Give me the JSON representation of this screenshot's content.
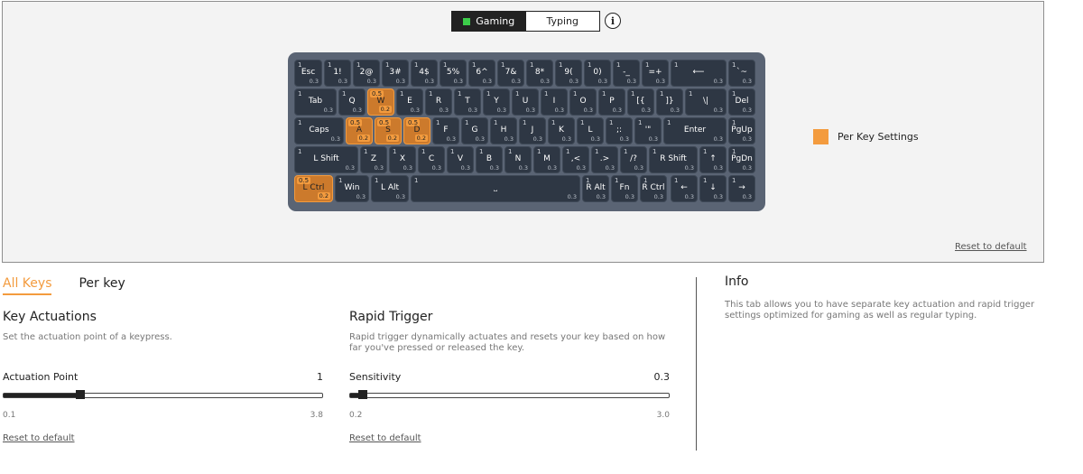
{
  "mode_toggle": {
    "gaming_label": "Gaming",
    "typing_label": "Typing",
    "active": "Gaming",
    "active_color": "#3ccd4a"
  },
  "info_icon": "i",
  "keyboard": {
    "rows": [
      [
        {
          "label": "Esc",
          "act": "1",
          "rt": "0.3"
        },
        {
          "label": "1!",
          "act": "1",
          "rt": "0.3"
        },
        {
          "label": "2@",
          "act": "1",
          "rt": "0.3"
        },
        {
          "label": "3#",
          "act": "1",
          "rt": "0.3"
        },
        {
          "label": "4$",
          "act": "1",
          "rt": "0.3"
        },
        {
          "label": "5%",
          "act": "1",
          "rt": "0.3"
        },
        {
          "label": "6^",
          "act": "1",
          "rt": "0.3"
        },
        {
          "label": "7&",
          "act": "1",
          "rt": "0.3"
        },
        {
          "label": "8*",
          "act": "1",
          "rt": "0.3"
        },
        {
          "label": "9(",
          "act": "1",
          "rt": "0.3"
        },
        {
          "label": "0)",
          "act": "1",
          "rt": "0.3"
        },
        {
          "label": "-_",
          "act": "1",
          "rt": "0.3"
        },
        {
          "label": "=+",
          "act": "1",
          "rt": "0.3"
        },
        {
          "label": "⟵",
          "act": "1",
          "rt": "0.3"
        },
        {
          "label": "`~",
          "act": "1",
          "rt": "0.3"
        }
      ],
      [
        {
          "label": "Tab",
          "act": "1",
          "rt": "0.3"
        },
        {
          "label": "Q",
          "act": "1",
          "rt": "0.3"
        },
        {
          "label": "W",
          "act": "0.5",
          "rt": "0.2",
          "hl": true
        },
        {
          "label": "E",
          "act": "1",
          "rt": "0.3"
        },
        {
          "label": "R",
          "act": "1",
          "rt": "0.3"
        },
        {
          "label": "T",
          "act": "1",
          "rt": "0.3"
        },
        {
          "label": "Y",
          "act": "1",
          "rt": "0.3"
        },
        {
          "label": "U",
          "act": "1",
          "rt": "0.3"
        },
        {
          "label": "I",
          "act": "1",
          "rt": "0.3"
        },
        {
          "label": "O",
          "act": "1",
          "rt": "0.3"
        },
        {
          "label": "P",
          "act": "1",
          "rt": "0.3"
        },
        {
          "label": "[{",
          "act": "1",
          "rt": "0.3"
        },
        {
          "label": "]}",
          "act": "1",
          "rt": "0.3"
        },
        {
          "label": "\\|",
          "act": "1",
          "rt": "0.3"
        },
        {
          "label": "Del",
          "act": "1",
          "rt": "0.3"
        }
      ],
      [
        {
          "label": "Caps",
          "act": "1",
          "rt": "0.3"
        },
        {
          "label": "A",
          "act": "0.5",
          "rt": "0.2",
          "hl": true
        },
        {
          "label": "S",
          "act": "0.5",
          "rt": "0.2",
          "hl": true
        },
        {
          "label": "D",
          "act": "0.5",
          "rt": "0.2",
          "hl": true
        },
        {
          "label": "F",
          "act": "1",
          "rt": "0.3"
        },
        {
          "label": "G",
          "act": "1",
          "rt": "0.3"
        },
        {
          "label": "H",
          "act": "1",
          "rt": "0.3"
        },
        {
          "label": "J",
          "act": "1",
          "rt": "0.3"
        },
        {
          "label": "K",
          "act": "1",
          "rt": "0.3"
        },
        {
          "label": "L",
          "act": "1",
          "rt": "0.3"
        },
        {
          "label": ";:",
          "act": "1",
          "rt": "0.3"
        },
        {
          "label": "'\"",
          "act": "1",
          "rt": "0.3"
        },
        {
          "label": "Enter",
          "act": "1",
          "rt": "0.3"
        },
        {
          "label": "PgUp",
          "act": "1",
          "rt": "0.3"
        }
      ],
      [
        {
          "label": "L Shift",
          "act": "1",
          "rt": "0.3"
        },
        {
          "label": "Z",
          "act": "1",
          "rt": "0.3"
        },
        {
          "label": "X",
          "act": "1",
          "rt": "0.3"
        },
        {
          "label": "C",
          "act": "1",
          "rt": "0.3"
        },
        {
          "label": "V",
          "act": "1",
          "rt": "0.3"
        },
        {
          "label": "B",
          "act": "1",
          "rt": "0.3"
        },
        {
          "label": "N",
          "act": "1",
          "rt": "0.3"
        },
        {
          "label": "M",
          "act": "1",
          "rt": "0.3"
        },
        {
          "label": ",<",
          "act": "1",
          "rt": "0.3"
        },
        {
          "label": ".>",
          "act": "1",
          "rt": "0.3"
        },
        {
          "label": "/?",
          "act": "1",
          "rt": "0.3"
        },
        {
          "label": "R Shift",
          "act": "1",
          "rt": "0.3"
        },
        {
          "label": "↑",
          "act": "1",
          "rt": "0.3"
        },
        {
          "label": "PgDn",
          "act": "1",
          "rt": "0.3"
        }
      ],
      [
        {
          "label": "L Ctrl",
          "act": "0.5",
          "rt": "0.2",
          "hl": true
        },
        {
          "label": "Win",
          "act": "1",
          "rt": "0.3"
        },
        {
          "label": "L Alt",
          "act": "1",
          "rt": "0.3"
        },
        {
          "label": "⎵",
          "act": "1",
          "rt": "0.3"
        },
        {
          "label": "R Alt",
          "act": "1",
          "rt": "0.3"
        },
        {
          "label": "Fn",
          "act": "1",
          "rt": "0.3"
        },
        {
          "label": "R Ctrl",
          "act": "1",
          "rt": "0.3"
        },
        {
          "label": "←",
          "act": "1",
          "rt": "0.3"
        },
        {
          "label": "↓",
          "act": "1",
          "rt": "0.3"
        },
        {
          "label": "→",
          "act": "1",
          "rt": "0.3"
        }
      ]
    ]
  },
  "legend": {
    "label": "Per Key Settings",
    "color": "#f39b3e"
  },
  "reset_label": "Reset to default",
  "tabs": [
    {
      "label": "All Keys",
      "active": true
    },
    {
      "label": "Per key",
      "active": false
    }
  ],
  "key_actuations": {
    "title": "Key Actuations",
    "desc": "Set the actuation point of a keypress.",
    "slider_label": "Actuation Point",
    "value": "1",
    "level": 0.24,
    "min": "0.1",
    "max": "3.8"
  },
  "rapid_trigger": {
    "title": "Rapid Trigger",
    "desc": "Rapid trigger dynamically actuates and resets your key based on how far you've pressed or released the key.",
    "slider_label": "Sensitivity",
    "value": "0.3",
    "level": 0.04,
    "min": "0.2",
    "max": "3.0"
  },
  "info": {
    "title": "Info",
    "text": "This tab allows you to have separate key actuation and rapid trigger settings optimized for gaming as well as regular typing."
  },
  "accent_color": "#f39b3e"
}
